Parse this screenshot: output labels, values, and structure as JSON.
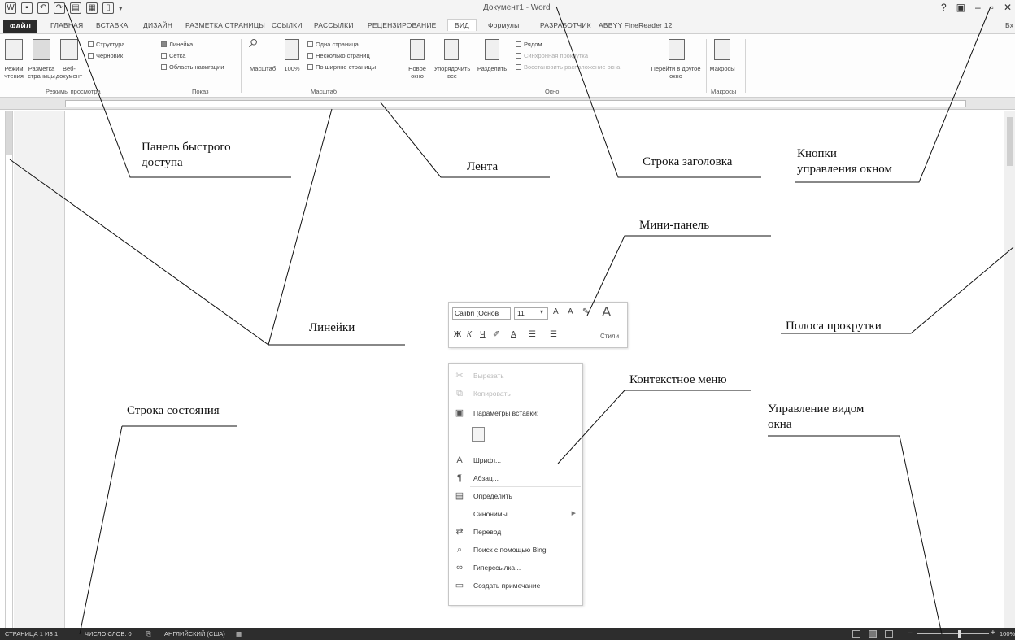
{
  "window": {
    "title": "Документ1 - Word",
    "controls": [
      "?",
      "▣",
      "–",
      "▫",
      "✕"
    ],
    "signin": "Вх"
  },
  "ribbon_tabs": [
    "ФАЙЛ",
    "ГЛАВНАЯ",
    "ВСТАВКА",
    "ДИЗАЙН",
    "РАЗМЕТКА СТРАНИЦЫ",
    "ССЫЛКИ",
    "РАССЫЛКИ",
    "РЕЦЕНЗИРОВАНИЕ",
    "ВИД",
    "Формулы",
    "РАЗРАБОТЧИК",
    "ABBYY FineReader 12"
  ],
  "ribbon": {
    "groups": {
      "view_modes": "Режимы просмотра",
      "show": "Показ",
      "zoom": "Масштаб",
      "window": "Окно",
      "macros": "Макросы"
    },
    "buttons": {
      "read_mode": "Режим чтения",
      "print_layout": "Разметка страницы",
      "web_layout": "Веб-документ",
      "outline": "Структура",
      "draft": "Черновик",
      "ruler": "Линейка",
      "grid": "Сетка",
      "nav_pane": "Область навигации",
      "zoom": "Масштаб",
      "zoom100": "100%",
      "one_page": "Одна страница",
      "multi_page": "Несколько страниц",
      "page_width": "По ширине страницы",
      "new_window": "Новое окно",
      "arrange_all": "Упорядочить все",
      "split": "Разделить",
      "side_by_side": "Рядом",
      "sync_scroll": "Синхронная прокрутка",
      "reset_position": "Восстановить расположение окна",
      "switch_window": "Перейти в другое окно",
      "macros": "Макросы"
    }
  },
  "mini_toolbar": {
    "font": "Calibri (Основ",
    "size": "11",
    "styles": "Стили"
  },
  "context_menu": {
    "items": [
      {
        "label": "Вырезать",
        "icon": "scissors-icon",
        "disabled": true
      },
      {
        "label": "Копировать",
        "icon": "copy-icon",
        "disabled": true
      },
      {
        "label": "Параметры вставки:",
        "icon": "paste-icon",
        "disabled": false
      },
      {
        "label": "Шрифт...",
        "icon": "font-icon",
        "disabled": false
      },
      {
        "label": "Абзац...",
        "icon": "paragraph-icon",
        "disabled": false
      },
      {
        "label": "Определить",
        "icon": "define-icon",
        "disabled": false
      },
      {
        "label": "Синонимы",
        "icon": "",
        "disabled": false,
        "submenu": true
      },
      {
        "label": "Перевод",
        "icon": "translate-icon",
        "disabled": false
      },
      {
        "label": "Поиск с помощью Bing",
        "icon": "bing-search-icon",
        "disabled": false
      },
      {
        "label": "Гиперссылка...",
        "icon": "hyperlink-icon",
        "disabled": false
      },
      {
        "label": "Создать примечание",
        "icon": "comment-icon",
        "disabled": false
      }
    ]
  },
  "status_bar": {
    "page": "СТРАНИЦА 1 ИЗ 1",
    "words": "ЧИСЛО СЛОВ: 0",
    "language": "АНГЛИЙСКИЙ (США)",
    "zoom": "100%"
  },
  "callouts": {
    "qat": "Панель быстрого\nдоступа",
    "ribbon": "Лента",
    "title_bar": "Строка заголовка",
    "window_buttons": "Кнопки\nуправления окном",
    "mini_panel": "Мини-панель",
    "rulers": "Линейки",
    "scrollbar": "Полоса прокрутки",
    "context_menu": "Контекстное меню",
    "status_bar": "Строка состояния",
    "view_controls": "Управление видом\nокна"
  }
}
